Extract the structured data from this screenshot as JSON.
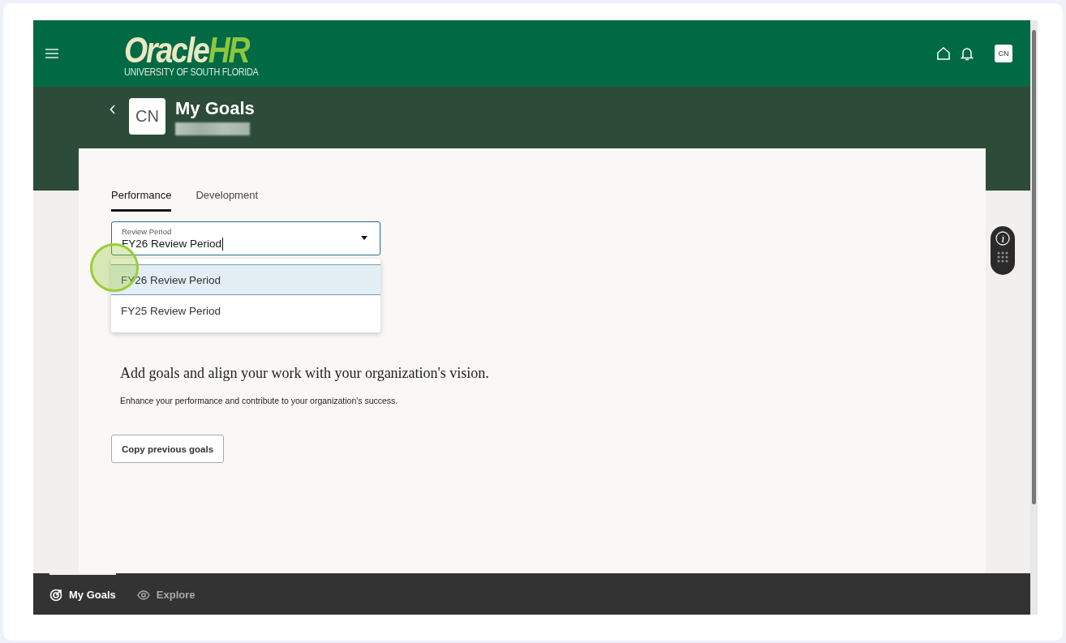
{
  "header": {
    "logo": {
      "brand": "Oracle",
      "brand_accent": "HR",
      "subtitle": "UNIVERSITY OF SOUTH FLORIDA"
    },
    "avatar": "CN"
  },
  "page": {
    "title": "My Goals",
    "avatar": "CN"
  },
  "tabs": [
    {
      "label": "Performance",
      "selected": true
    },
    {
      "label": "Development",
      "selected": false
    }
  ],
  "review_period": {
    "label": "Review Period",
    "value": "FY26 Review Period"
  },
  "options": [
    {
      "label": "FY26 Review Period",
      "selected": true
    },
    {
      "label": "FY25 Review Period",
      "selected": false
    }
  ],
  "empty_state": {
    "heading": "Add goals and align your work with your organization's vision.",
    "text": "Enhance your performance and contribute to your organization's success."
  },
  "buttons": [
    "Copy previous goals"
  ],
  "bottom_nav": [
    {
      "label": "My Goals",
      "selected": true,
      "kind": "goals"
    },
    {
      "label": "Explore",
      "selected": false,
      "kind": "explore"
    }
  ]
}
